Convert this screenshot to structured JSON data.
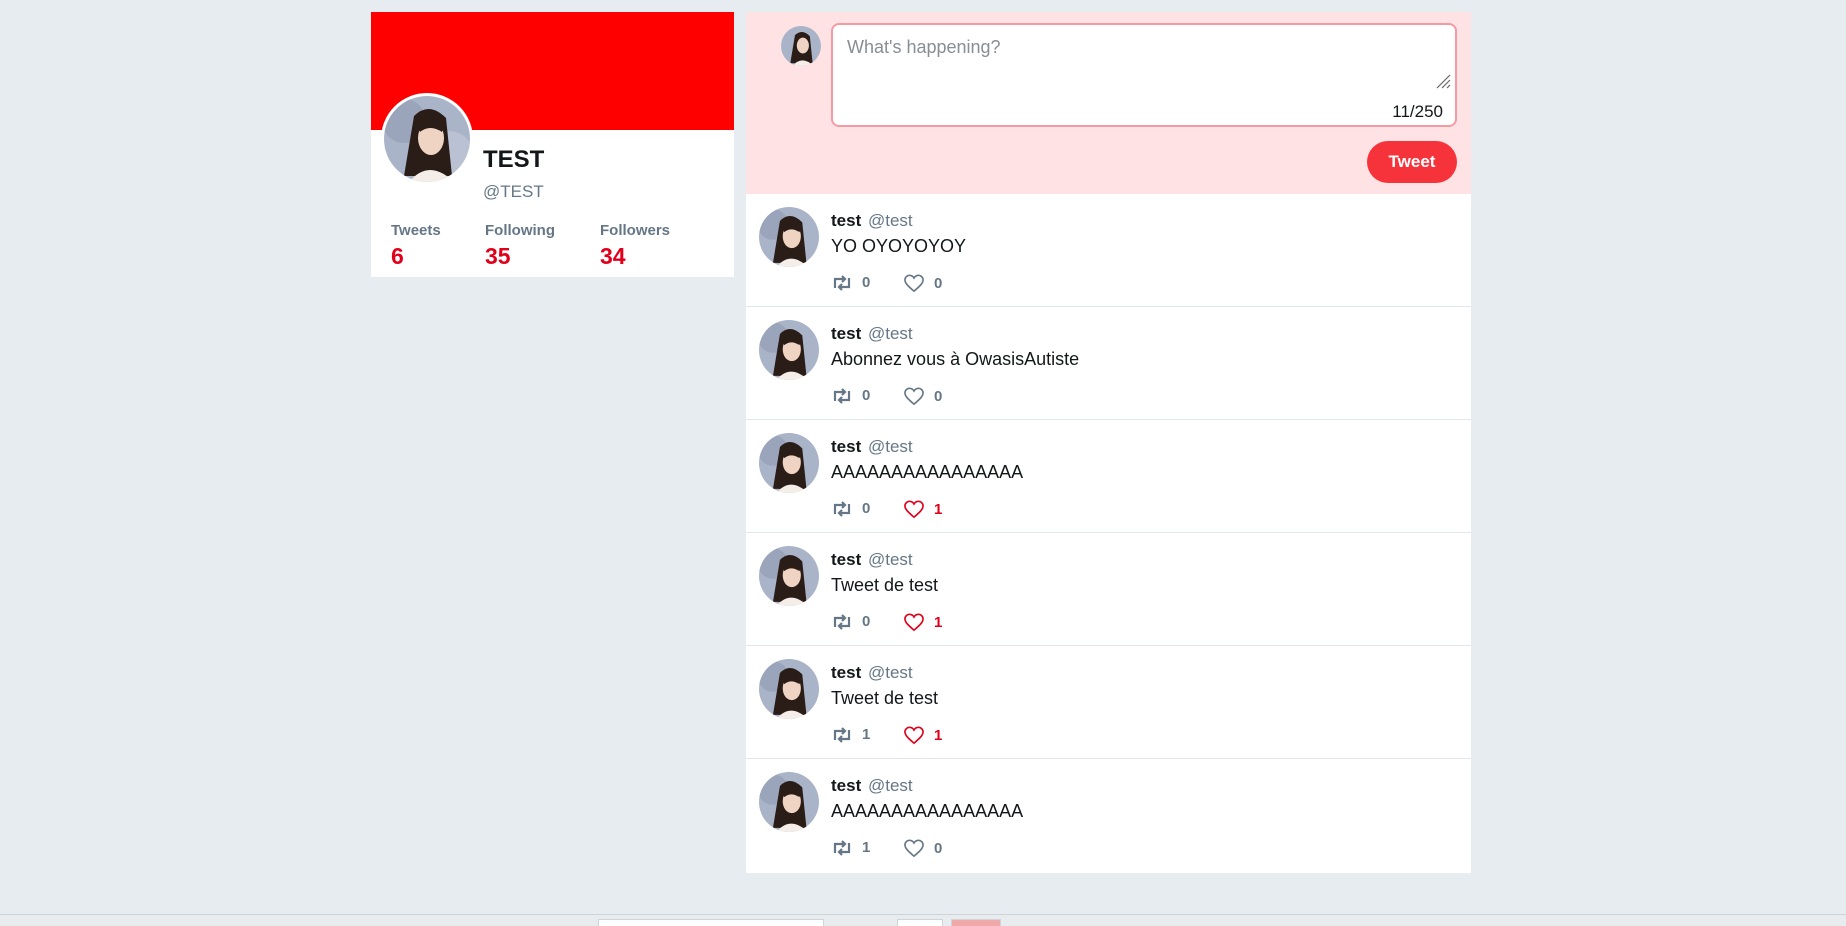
{
  "profile": {
    "name": "TEST",
    "handle": "@TEST",
    "banner_color": "#ff0000",
    "stats": [
      {
        "label": "Tweets",
        "value": "6"
      },
      {
        "label": "Following",
        "value": "35"
      },
      {
        "label": "Followers",
        "value": "34"
      }
    ]
  },
  "composer": {
    "placeholder": "What's happening?",
    "counter": "11/250",
    "button_label": "Tweet"
  },
  "tweets": [
    {
      "name": "test",
      "handle": "@test",
      "text": "YO OYOYOYOY",
      "retweets": "0",
      "likes": "0",
      "liked": false
    },
    {
      "name": "test",
      "handle": "@test",
      "text": "Abonnez vous à OwasisAutiste",
      "retweets": "0",
      "likes": "0",
      "liked": false
    },
    {
      "name": "test",
      "handle": "@test",
      "text": "AAAAAAAAAAAAAAAA",
      "retweets": "0",
      "likes": "1",
      "liked": true
    },
    {
      "name": "test",
      "handle": "@test",
      "text": "Tweet de test",
      "retweets": "0",
      "likes": "1",
      "liked": true
    },
    {
      "name": "test",
      "handle": "@test",
      "text": "Tweet de test",
      "retweets": "1",
      "likes": "1",
      "liked": true
    },
    {
      "name": "test",
      "handle": "@test",
      "text": "AAAAAAAAAAAAAAAA",
      "retweets": "1",
      "likes": "0",
      "liked": false
    }
  ],
  "colors": {
    "accent": "#f6323b",
    "stat_value": "#e0001a",
    "composer_bg": "#ffe3e4",
    "page_bg": "#e6ecf0"
  }
}
